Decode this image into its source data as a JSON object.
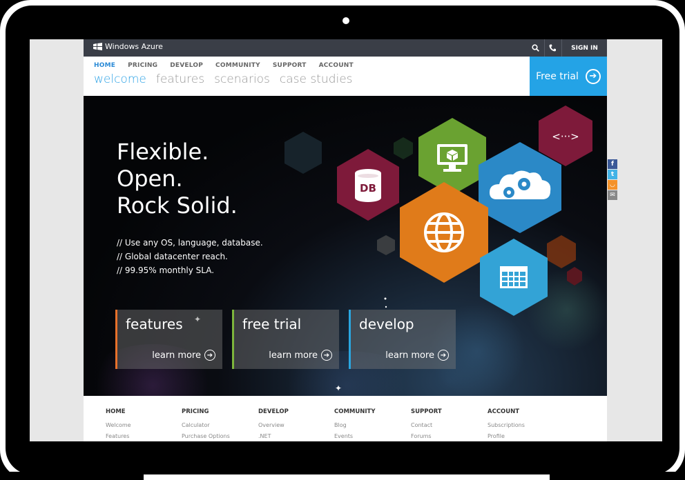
{
  "site": {
    "logo_text": "Windows Azure",
    "sign_in": "SIGN IN",
    "nav": [
      "HOME",
      "PRICING",
      "DEVELOP",
      "COMMUNITY",
      "SUPPORT",
      "ACCOUNT"
    ],
    "subnav": [
      "welcome",
      "features",
      "scenarios",
      "case studies"
    ],
    "free_trial": "Free trial"
  },
  "hero": {
    "headline": [
      "Flexible.",
      "Open.",
      "Rock Solid."
    ],
    "bullets": [
      "// Use any OS, language, database.",
      "// Global datacenter reach.",
      "// 99.95% monthly SLA."
    ],
    "hex_labels": {
      "db": "DB",
      "code": "<···>"
    },
    "tiles": [
      {
        "title": "features",
        "more": "learn more",
        "accent": "#e8712a"
      },
      {
        "title": "free trial",
        "more": "learn more",
        "accent": "#7db53c"
      },
      {
        "title": "develop",
        "more": "learn more",
        "accent": "#2aa6e0"
      }
    ]
  },
  "share": [
    {
      "icon": "facebook-icon",
      "glyph": "f",
      "color": "#3b5998"
    },
    {
      "icon": "twitter-icon",
      "glyph": "t",
      "color": "#42b3e6"
    },
    {
      "icon": "rss-icon",
      "glyph": "◡",
      "color": "#f4922a"
    },
    {
      "icon": "email-icon",
      "glyph": "✉",
      "color": "#888"
    }
  ],
  "footer": {
    "columns": [
      {
        "head": "HOME",
        "links": [
          "Welcome",
          "Features"
        ]
      },
      {
        "head": "PRICING",
        "links": [
          "Calculator",
          "Purchase Options"
        ]
      },
      {
        "head": "DEVELOP",
        "links": [
          "Overview",
          ".NET"
        ]
      },
      {
        "head": "COMMUNITY",
        "links": [
          "Blog",
          "Events"
        ]
      },
      {
        "head": "SUPPORT",
        "links": [
          "Contact",
          "Forums"
        ]
      },
      {
        "head": "ACCOUNT",
        "links": [
          "Subscriptions",
          "Profile"
        ]
      }
    ]
  },
  "colors": {
    "accent_blue": "#24a3e6",
    "hex_burgundy": "#7e1a3a",
    "hex_green": "#6aa231",
    "hex_orange": "#e07b1a",
    "hex_blue": "#2b89c7",
    "hex_light_blue": "#33a3d6"
  }
}
